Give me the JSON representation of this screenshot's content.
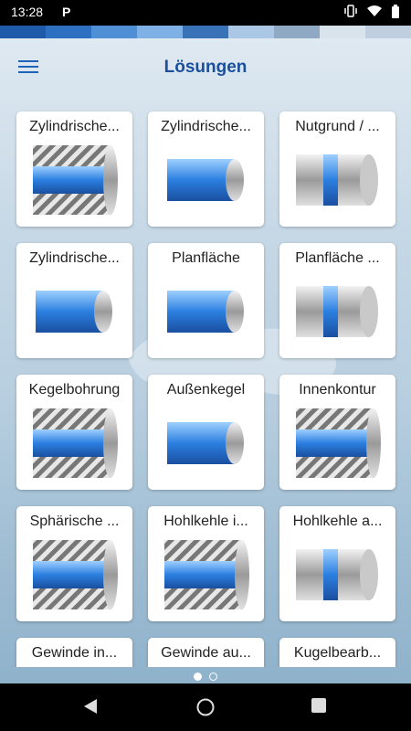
{
  "status": {
    "time": "13:28",
    "app_icon": "P"
  },
  "colors": {
    "title": "#1b4f9c",
    "accent": "#1d63b8",
    "part_blue": "#2b7fe0"
  },
  "strip_colors": [
    "#1e5aa8",
    "#2d6fc0",
    "#4f8fd6",
    "#7fb1e6",
    "#3a72b8",
    "#aac8e6",
    "#8fa9c4",
    "#d9e3ec",
    "#bfcfdf"
  ],
  "header": {
    "title": "Lösungen",
    "menu_icon": "hamburger-menu-icon"
  },
  "cards": [
    {
      "label": "Zylindrische...",
      "icon": "cylinder-bore-icon"
    },
    {
      "label": "Zylindrische...",
      "icon": "cylinder-shaft-icon"
    },
    {
      "label": "Nutgrund / ...",
      "icon": "groove-base-icon"
    },
    {
      "label": "Zylindrische...",
      "icon": "cylinder-shoulder-icon"
    },
    {
      "label": "Planfläche",
      "icon": "face-surface-icon"
    },
    {
      "label": "Planfläche ...",
      "icon": "face-surface-2-icon"
    },
    {
      "label": "Kegelbohrung",
      "icon": "taper-bore-icon"
    },
    {
      "label": "Außenkegel",
      "icon": "outer-taper-icon"
    },
    {
      "label": "Innenkontur",
      "icon": "inner-contour-icon"
    },
    {
      "label": "Sphärische ...",
      "icon": "spherical-icon"
    },
    {
      "label": "Hohlkehle i...",
      "icon": "inner-fillet-icon"
    },
    {
      "label": "Hohlkehle a...",
      "icon": "outer-fillet-icon"
    },
    {
      "label": "Gewinde in...",
      "icon": "thread-inner-icon"
    },
    {
      "label": "Gewinde au...",
      "icon": "thread-outer-icon"
    },
    {
      "label": "Kugelbearb...",
      "icon": "ball-machining-icon"
    }
  ],
  "pager": {
    "pages": 2,
    "current": 1
  },
  "nav": {
    "back": "back-icon",
    "home": "home-icon",
    "recents": "recents-icon"
  }
}
